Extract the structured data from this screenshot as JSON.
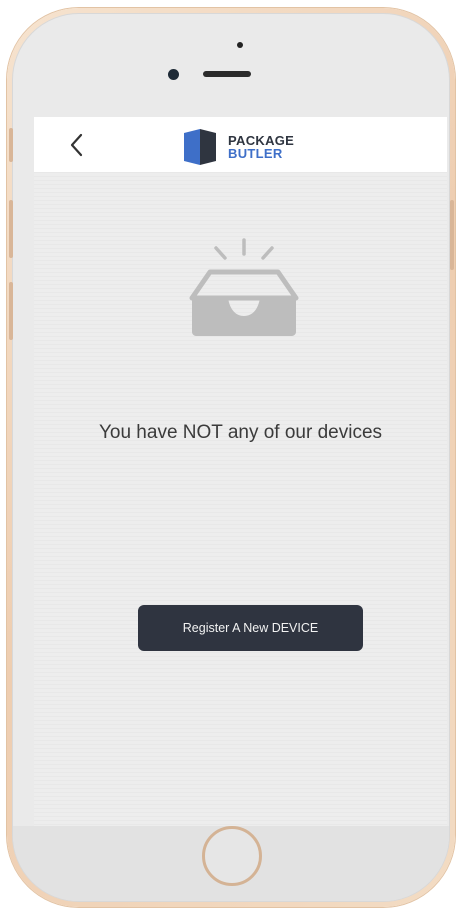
{
  "header": {
    "logo_line1": "PACKAGE",
    "logo_line2": "BUTLER",
    "back_icon": "chevron-left-icon"
  },
  "empty_state": {
    "icon": "empty-inbox-icon",
    "message": "You have NOT any of our devices"
  },
  "actions": {
    "register_label": "Register A New DEVICE"
  },
  "colors": {
    "brand_dark": "#2f3540",
    "brand_blue": "#3e6fc8",
    "button_bg": "#2f3440",
    "phone_frame": "#eecdb0"
  }
}
